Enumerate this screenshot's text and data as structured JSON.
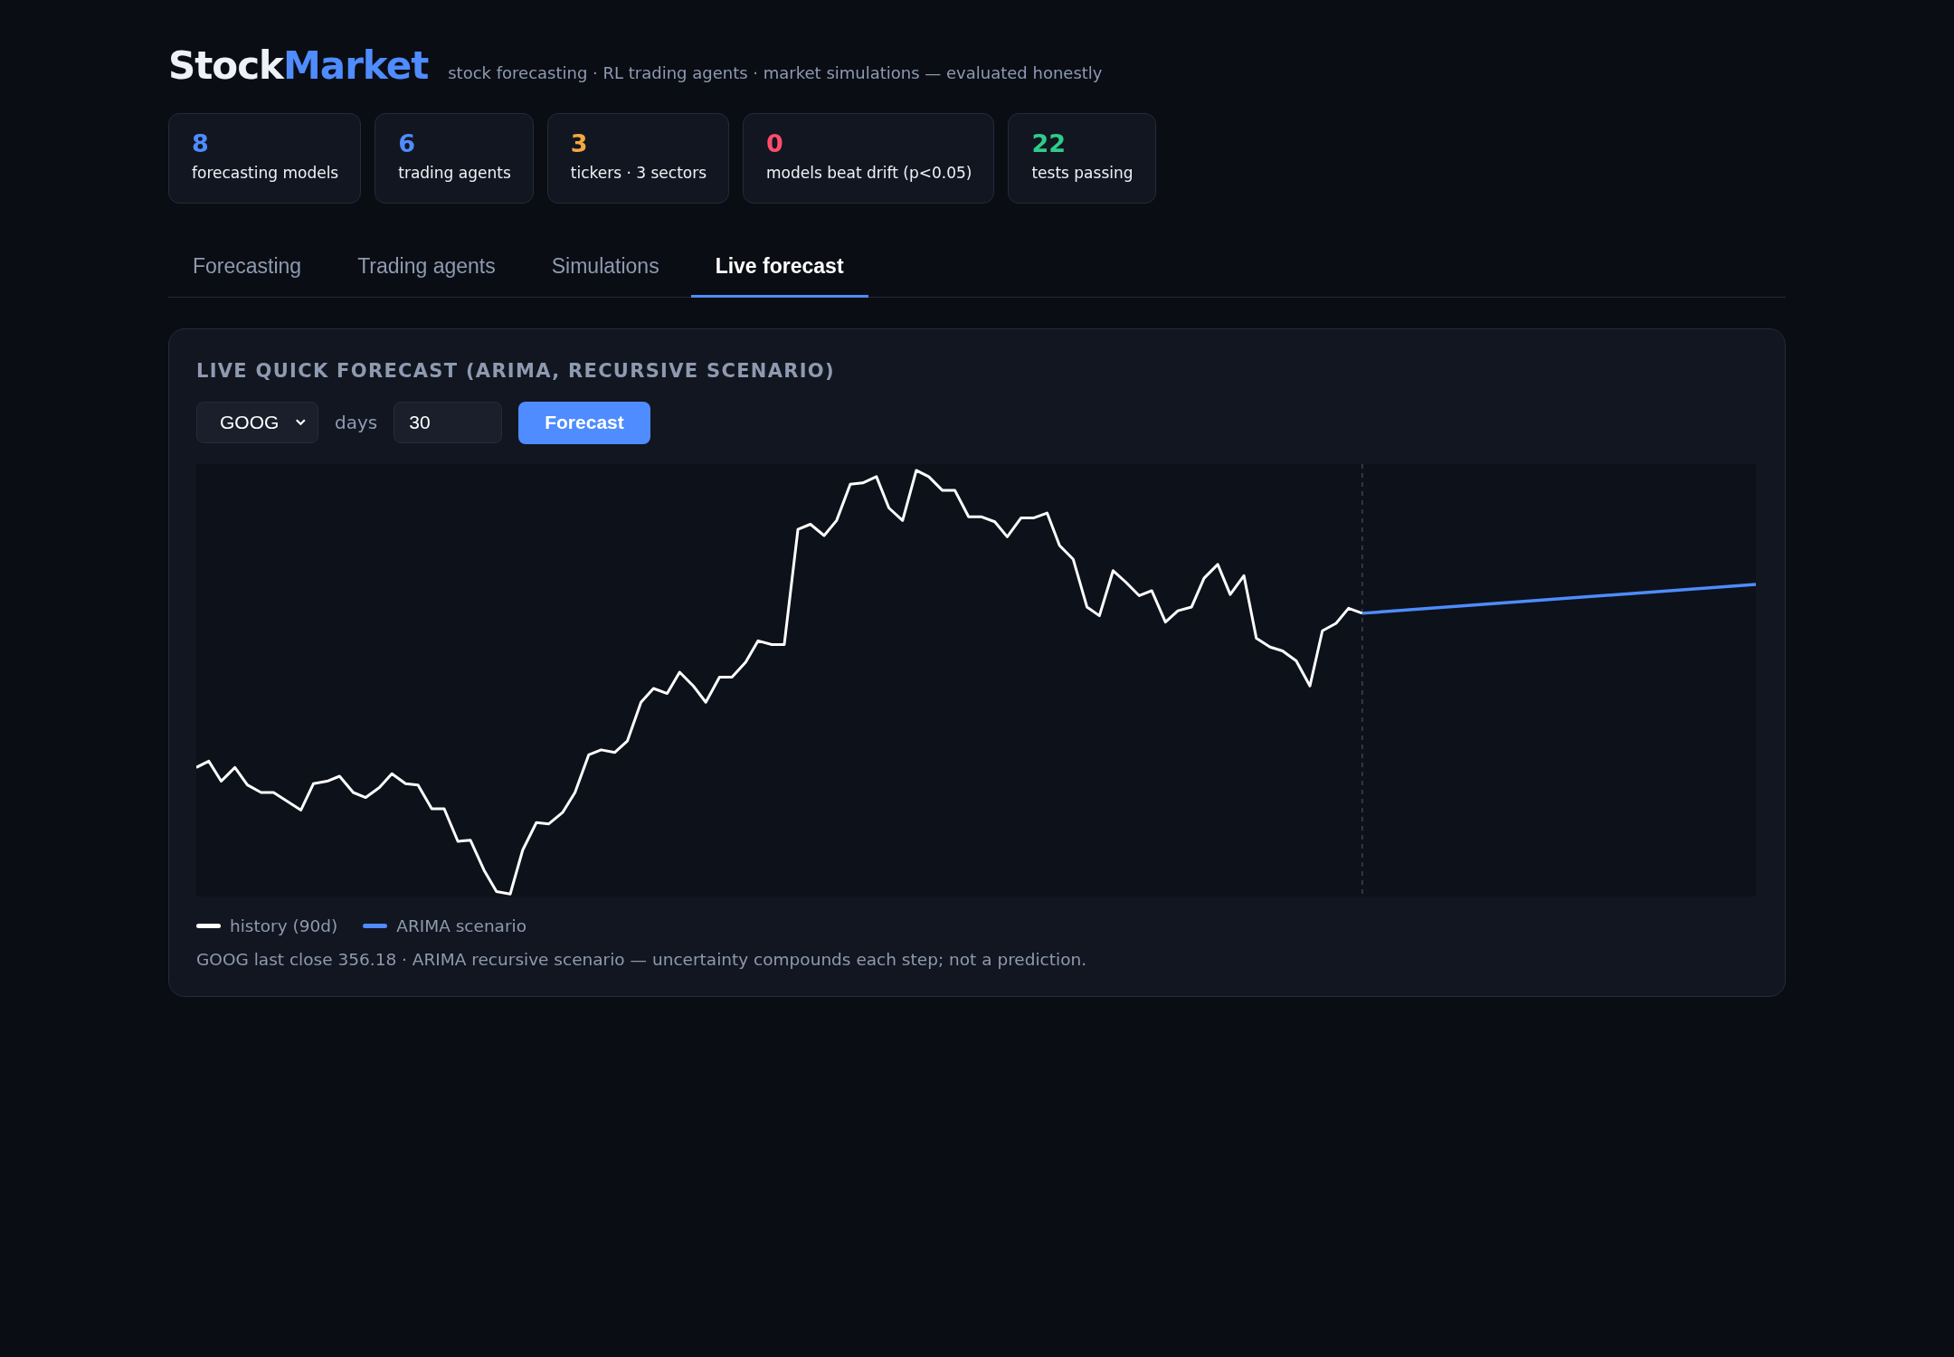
{
  "brand": {
    "prefix": "Stock",
    "accent": "Market",
    "tagline": "stock forecasting · RL trading agents · market simulations — evaluated honestly"
  },
  "stats": [
    {
      "value": "8",
      "label": "forecasting models",
      "color": "#4f8cff"
    },
    {
      "value": "6",
      "label": "trading agents",
      "color": "#4f8cff"
    },
    {
      "value": "3",
      "label": "tickers · 3 sectors",
      "color": "#f5a742"
    },
    {
      "value": "0",
      "label": "models beat drift (p<0.05)",
      "color": "#ff4d6d"
    },
    {
      "value": "22",
      "label": "tests passing",
      "color": "#2ecc8a"
    }
  ],
  "tabs": [
    {
      "label": "Forecasting",
      "selected": false
    },
    {
      "label": "Trading agents",
      "selected": false
    },
    {
      "label": "Simulations",
      "selected": false
    },
    {
      "label": "Live forecast",
      "selected": true
    }
  ],
  "panel": {
    "title": "LIVE QUICK FORECAST (ARIMA, RECURSIVE SCENARIO)",
    "ticker_select": {
      "value": "GOOG"
    },
    "days_label": "days",
    "days_field": {
      "value": "30"
    },
    "forecast_button": "Forecast",
    "legend": [
      {
        "label": "history (90d)",
        "color": "#ffffff"
      },
      {
        "label": "ARIMA scenario",
        "color": "#4f8cff"
      }
    ],
    "note": "GOOG last close 356.18 · ARIMA recursive scenario — uncertainty compounds each step; not a prediction."
  }
}
